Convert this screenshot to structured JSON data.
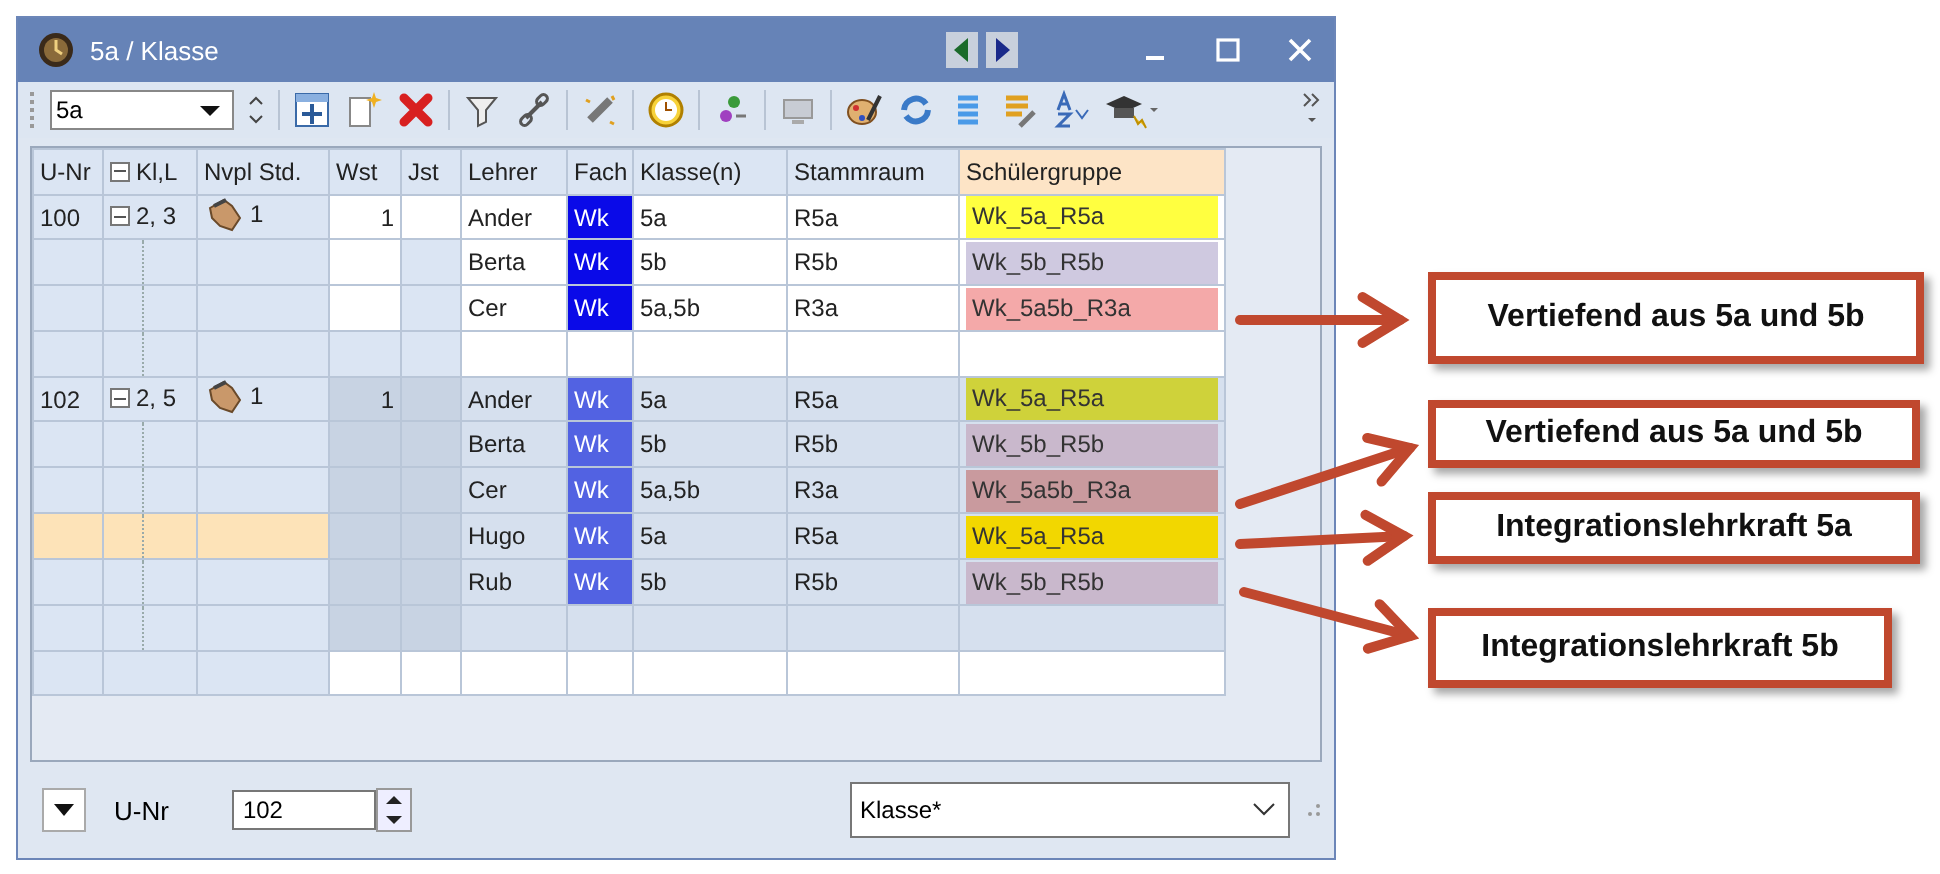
{
  "window": {
    "title": "5a / Klasse"
  },
  "toolbar": {
    "class_field": "5a"
  },
  "grid": {
    "columns": [
      "U-Nr",
      "Kl,L",
      "Nvpl Std.",
      "Wst",
      "Jst",
      "Lehrer",
      "Fach",
      "Klasse(n)",
      "Stammraum",
      "Schülergruppe"
    ],
    "groups": [
      {
        "u_nr": "100",
        "kl_l": "2, 3",
        "nvpl": "1",
        "wst": "1",
        "expanded": true,
        "current": false,
        "rows": [
          {
            "lehrer": "Ander",
            "fach": "Wk",
            "klasse": "5a",
            "stammraum": "R5a",
            "gruppe": "Wk_5a_R5a",
            "color": "#ffff40",
            "selected": false
          },
          {
            "lehrer": "Berta",
            "fach": "Wk",
            "klasse": "5b",
            "stammraum": "R5b",
            "gruppe": "Wk_5b_R5b",
            "color": "#cfc9e0",
            "selected": false
          },
          {
            "lehrer": "Cer",
            "fach": "Wk",
            "klasse": "5a,5b",
            "stammraum": "R3a",
            "gruppe": "Wk_5a5b_R3a",
            "color": "#f4a9a9",
            "selected": false
          }
        ]
      },
      {
        "u_nr": "102",
        "kl_l": "2, 5",
        "nvpl": "1",
        "wst": "1",
        "expanded": true,
        "current": true,
        "rows": [
          {
            "lehrer": "Ander",
            "fach": "Wk",
            "klasse": "5a",
            "stammraum": "R5a",
            "gruppe": "Wk_5a_R5a",
            "color": "#cfd23a",
            "selected": false
          },
          {
            "lehrer": "Berta",
            "fach": "Wk",
            "klasse": "5b",
            "stammraum": "R5b",
            "gruppe": "Wk_5b_R5b",
            "color": "#c9b8cc",
            "selected": false
          },
          {
            "lehrer": "Cer",
            "fach": "Wk",
            "klasse": "5a,5b",
            "stammraum": "R3a",
            "gruppe": "Wk_5a5b_R3a",
            "color": "#c99a9e",
            "selected": false
          },
          {
            "lehrer": "Hugo",
            "fach": "Wk",
            "klasse": "5a",
            "stammraum": "R5a",
            "gruppe": "Wk_5a_R5a",
            "color": "#f2d700",
            "selected": true
          },
          {
            "lehrer": "Rub",
            "fach": "Wk",
            "klasse": "5b",
            "stammraum": "R5b",
            "gruppe": "Wk_5b_R5b",
            "color": "#c9b8cc",
            "selected": false
          }
        ]
      }
    ]
  },
  "bottom_bar": {
    "label": "U-Nr",
    "value": "102",
    "view": "Klasse*"
  },
  "callouts": [
    {
      "text": "Vertiefend aus 5a und 5b"
    },
    {
      "text": "Vertiefend aus 5a und 5b"
    },
    {
      "text": "Integrationslehrkraft 5a"
    },
    {
      "text": "Integrationslehrkraft 5b"
    }
  ]
}
